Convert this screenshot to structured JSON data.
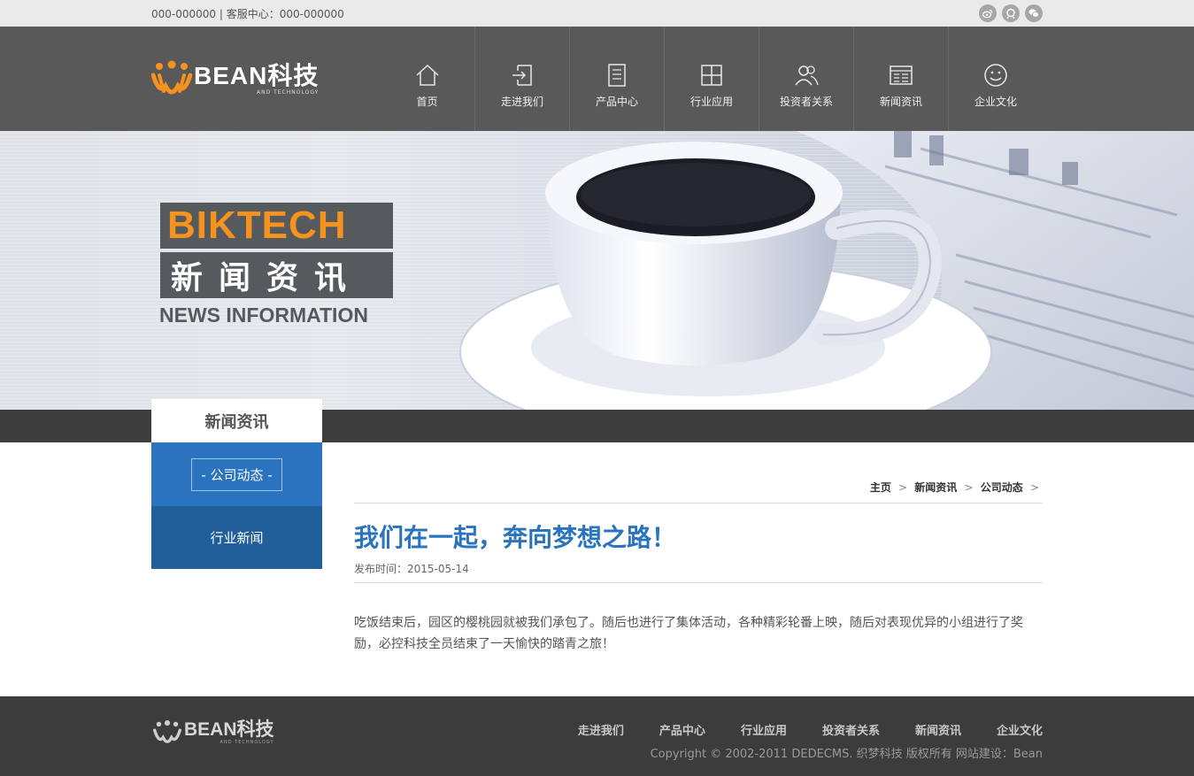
{
  "topbar": {
    "phone": "000-000000 | 客服中心：000-000000",
    "social": [
      "weibo-icon",
      "qq-icon",
      "wechat-icon"
    ]
  },
  "logo": {
    "brand": "BEAN科技",
    "sub": "AND TECHNOLOGY"
  },
  "nav": {
    "items": [
      {
        "label": "首页",
        "icon": "home-icon"
      },
      {
        "label": "走进我们",
        "icon": "enter-icon"
      },
      {
        "label": "产品中心",
        "icon": "document-icon"
      },
      {
        "label": "行业应用",
        "icon": "grid-icon"
      },
      {
        "label": "投资者关系",
        "icon": "users-icon"
      },
      {
        "label": "新闻资讯",
        "icon": "newspaper-icon"
      },
      {
        "label": "企业文化",
        "icon": "smile-icon"
      }
    ]
  },
  "banner": {
    "brand": "BIKTECH",
    "title_zh": "新闻资讯",
    "title_en": "NEWS INFORMATION"
  },
  "sidebar": {
    "heading": "新闻资讯",
    "current": "- 公司动态 -",
    "other": "行业新闻"
  },
  "breadcrumb": {
    "items": [
      "主页",
      "新闻资讯",
      "公司动态"
    ],
    "separator": ">"
  },
  "article": {
    "title": "我们在一起，奔向梦想之路！",
    "date": "发布时间：2015-05-14",
    "body": "吃饭结束后，园区的樱桃园就被我们承包了。随后也进行了集体活动，各种精彩轮番上映，随后对表现优异的小组进行了奖励，必控科技全员结束了一天愉快的踏青之旅！"
  },
  "footer": {
    "nav": [
      "走进我们",
      "产品中心",
      "行业应用",
      "投资者关系",
      "新闻资讯",
      "企业文化"
    ],
    "copyright": "Copyright © 2002-2011 DEDECMS. 织梦科技 版权所有 网站建设：Bean"
  },
  "colors": {
    "accent": "#2a73be",
    "orange": "#f6921e",
    "header_bg": "#595959",
    "footer_bg": "#3c3c3c"
  }
}
